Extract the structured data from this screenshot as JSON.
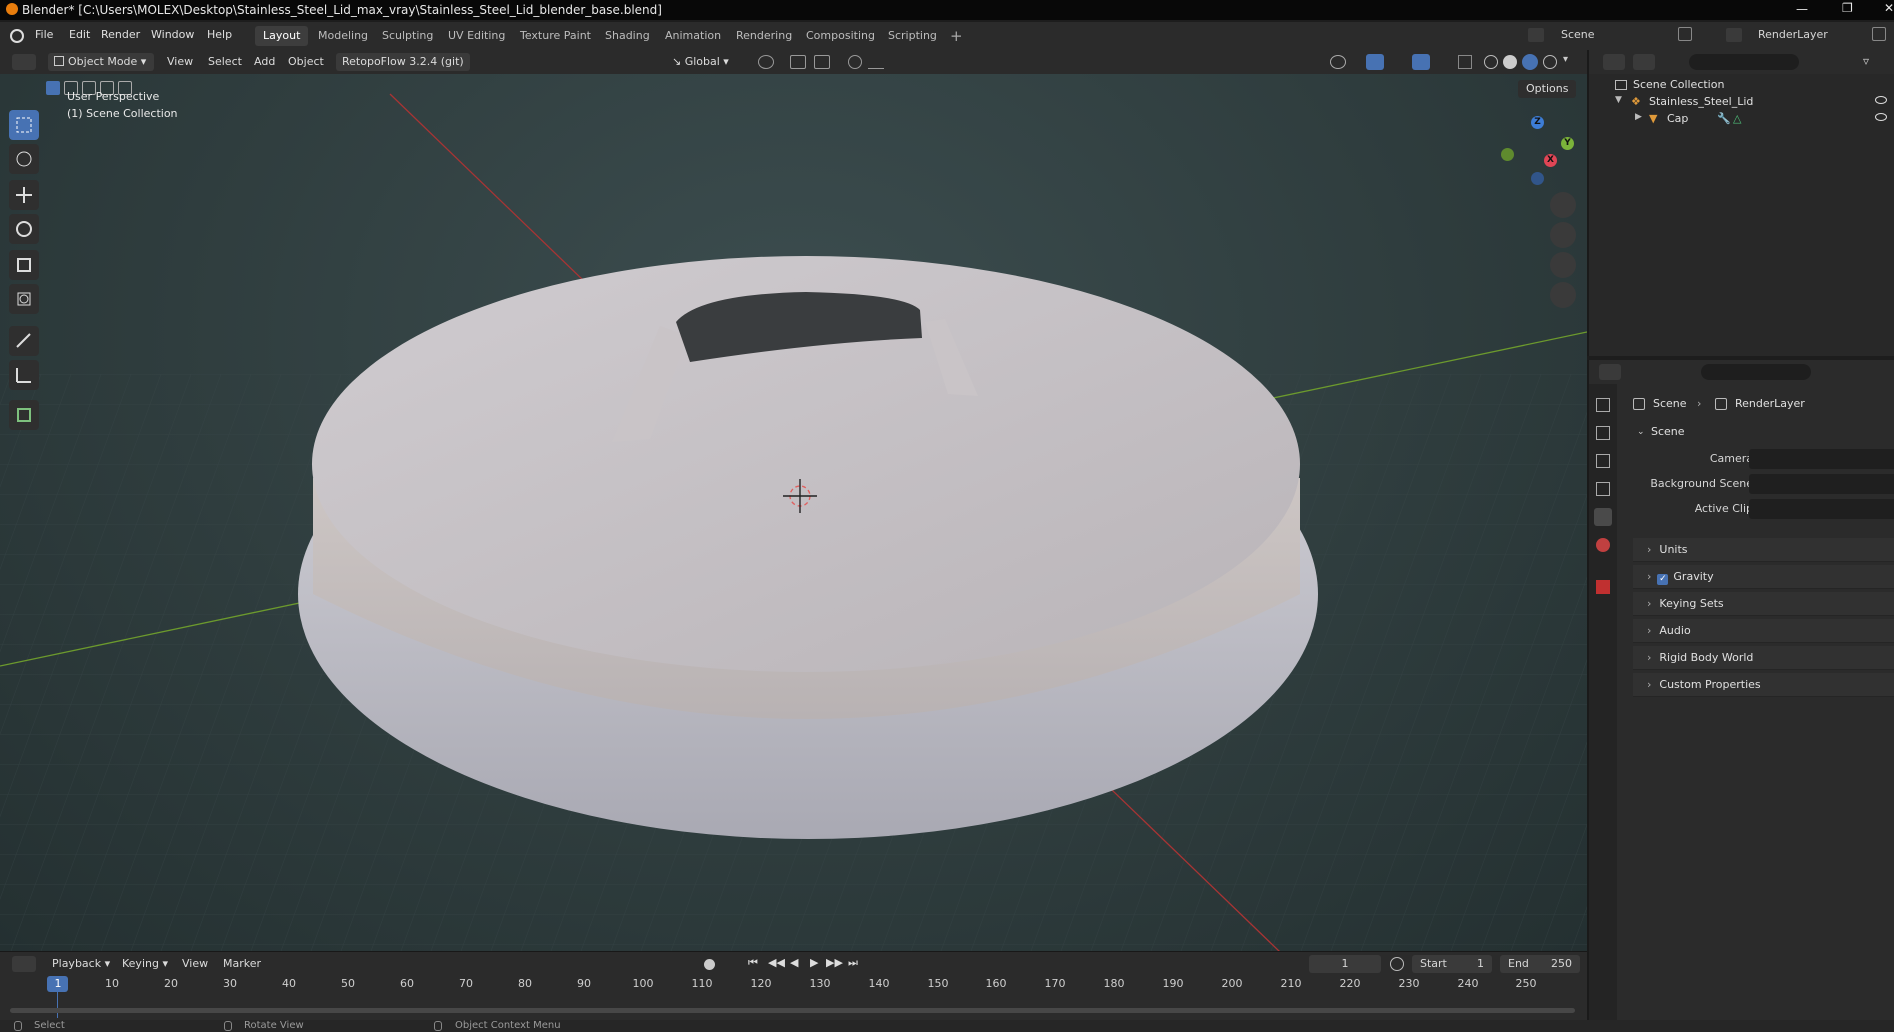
{
  "window": {
    "title": "Blender* [C:\\Users\\MOLEX\\Desktop\\Stainless_Steel_Lid_max_vray\\Stainless_Steel_Lid_blender_base.blend]"
  },
  "menu": [
    "File",
    "Edit",
    "Render",
    "Window",
    "Help"
  ],
  "workspaces": [
    "Layout",
    "Modeling",
    "Sculpting",
    "UV Editing",
    "Texture Paint",
    "Shading",
    "Animation",
    "Rendering",
    "Compositing",
    "Scripting"
  ],
  "active_workspace": "Layout",
  "topright": {
    "scene": "Scene",
    "view_layer": "RenderLayer"
  },
  "viewport_header": {
    "mode": "Object Mode",
    "menus": [
      "View",
      "Select",
      "Add",
      "Object"
    ],
    "addon": "RetopoFlow 3.2.4 (git)",
    "orientation": "Global",
    "options": "Options"
  },
  "viewport": {
    "perspective": "User Perspective",
    "collection": "(1) Scene Collection"
  },
  "gizmo": {
    "z": "Z",
    "y": "Y",
    "x": "X"
  },
  "outliner": {
    "root": "Scene Collection",
    "items": [
      {
        "label": "Stainless_Steel_Lid"
      },
      {
        "label": "Cap"
      }
    ]
  },
  "properties": {
    "breadcrumb": [
      "Scene",
      "RenderLayer"
    ],
    "section": "Scene",
    "fields": [
      {
        "label": "Camera"
      },
      {
        "label": "Background Scene"
      },
      {
        "label": "Active Clip"
      }
    ],
    "panels": [
      "Units",
      "Gravity",
      "Keying Sets",
      "Audio",
      "Rigid Body World",
      "Custom Properties"
    ],
    "gravity_checked": true
  },
  "timeline": {
    "menus": [
      "Playback",
      "Keying",
      "View",
      "Marker"
    ],
    "current_frame": "1",
    "start_label": "Start",
    "start": "1",
    "end_label": "End",
    "end": "250",
    "ticks": [
      "1",
      "10",
      "20",
      "30",
      "40",
      "50",
      "60",
      "70",
      "80",
      "90",
      "100",
      "110",
      "120",
      "130",
      "140",
      "150",
      "160",
      "170",
      "180",
      "190",
      "200",
      "210",
      "220",
      "230",
      "240",
      "250"
    ]
  },
  "statusbar": {
    "items": [
      "Select",
      "Rotate View",
      "Object Context Menu"
    ]
  }
}
